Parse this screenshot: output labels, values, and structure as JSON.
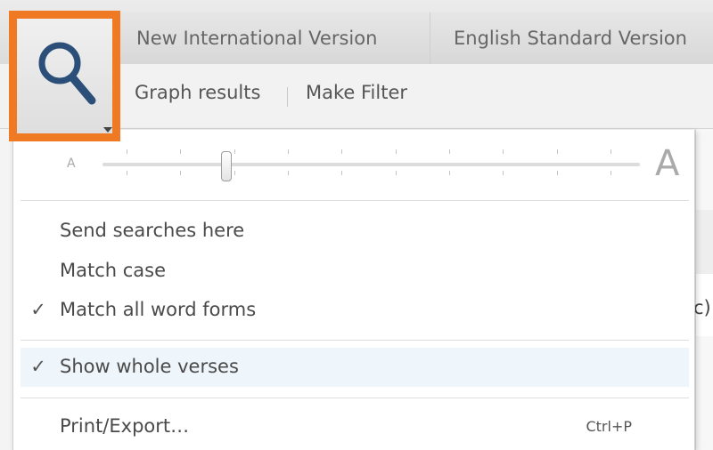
{
  "tabs": [
    {
      "label": "New International Version"
    },
    {
      "label": "English Standard Version"
    }
  ],
  "toolbar": {
    "graph_results": "Graph results",
    "make_filter": "Make Filter"
  },
  "search_button": {
    "icon": "magnifier-icon",
    "accent_color": "#f07a23"
  },
  "zoom": {
    "small_label": "A",
    "large_label": "A",
    "level": 0.23
  },
  "menu": {
    "items": [
      {
        "label": "Send searches here",
        "checked": false
      },
      {
        "label": "Match case",
        "checked": false
      },
      {
        "label": "Match all word forms",
        "checked": true
      },
      {
        "label": "Show whole verses",
        "checked": true
      },
      {
        "label": "Print/Export…",
        "shortcut": "Ctrl+P"
      }
    ],
    "check_glyph": "✓"
  },
  "background": {
    "clipped_text": "c)"
  }
}
